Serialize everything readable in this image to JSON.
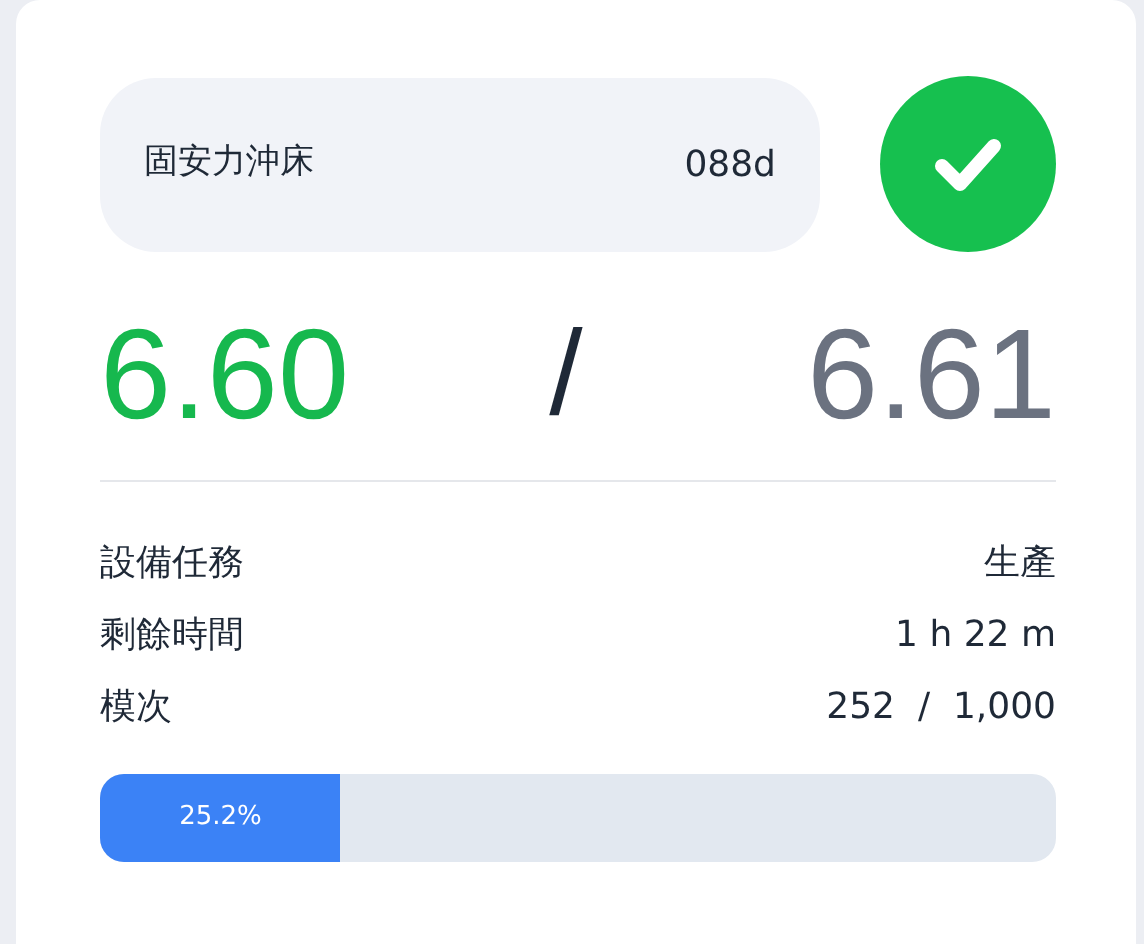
{
  "machine": {
    "name": "固安力沖床",
    "code": "088d",
    "ok": true
  },
  "readings": {
    "actual": "6.60",
    "separator": "/",
    "target": "6.61"
  },
  "details": [
    {
      "label": "設備任務",
      "value": "生產"
    },
    {
      "label": "剩餘時間",
      "value": "1 h 22 m"
    },
    {
      "label": "模次",
      "value": "252  /  1,000"
    }
  ],
  "progress": {
    "level": 0.252,
    "label": "25.2%"
  }
}
